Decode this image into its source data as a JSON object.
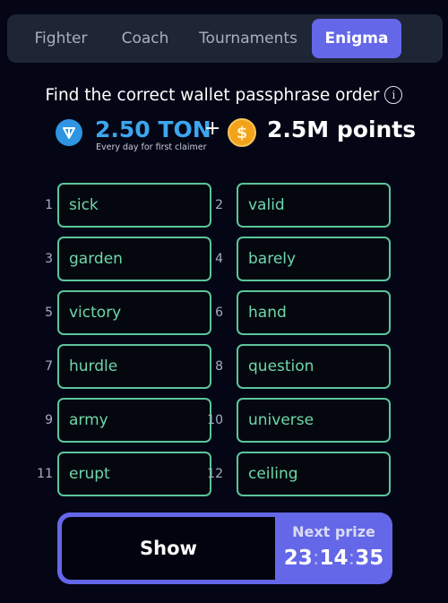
{
  "tabs": [
    {
      "label": "Fighter",
      "active": false
    },
    {
      "label": "Coach",
      "active": false
    },
    {
      "label": "Tournaments",
      "active": false
    },
    {
      "label": "Enigma",
      "active": true
    }
  ],
  "heading": {
    "title": "Find the correct wallet passphrase order",
    "info_icon": "info-circle-icon"
  },
  "reward": {
    "ton_icon": "ton-logo-icon",
    "ton_amount": "2.50 TON",
    "ton_subtitle": "Every day for first claimer",
    "plus": "+",
    "coin_icon": "dollar-coin-icon",
    "points": "2.5M points"
  },
  "words": [
    {
      "num": "1",
      "word": "sick"
    },
    {
      "num": "2",
      "word": "valid"
    },
    {
      "num": "3",
      "word": "garden"
    },
    {
      "num": "4",
      "word": "barely"
    },
    {
      "num": "5",
      "word": "victory"
    },
    {
      "num": "6",
      "word": "hand"
    },
    {
      "num": "7",
      "word": "hurdle"
    },
    {
      "num": "8",
      "word": "question"
    },
    {
      "num": "9",
      "word": "army"
    },
    {
      "num": "10",
      "word": "universe"
    },
    {
      "num": "11",
      "word": "erupt"
    },
    {
      "num": "12",
      "word": "ceiling"
    }
  ],
  "action": {
    "show_label": "Show",
    "next_prize_label": "Next prize",
    "countdown": {
      "hours": "23",
      "minutes": "14",
      "seconds": "35",
      "separator": ":"
    }
  },
  "colors": {
    "accent": "#6467e8",
    "word_green": "#5cc59a",
    "ton_blue": "#3da6ef",
    "background": "#040615"
  }
}
